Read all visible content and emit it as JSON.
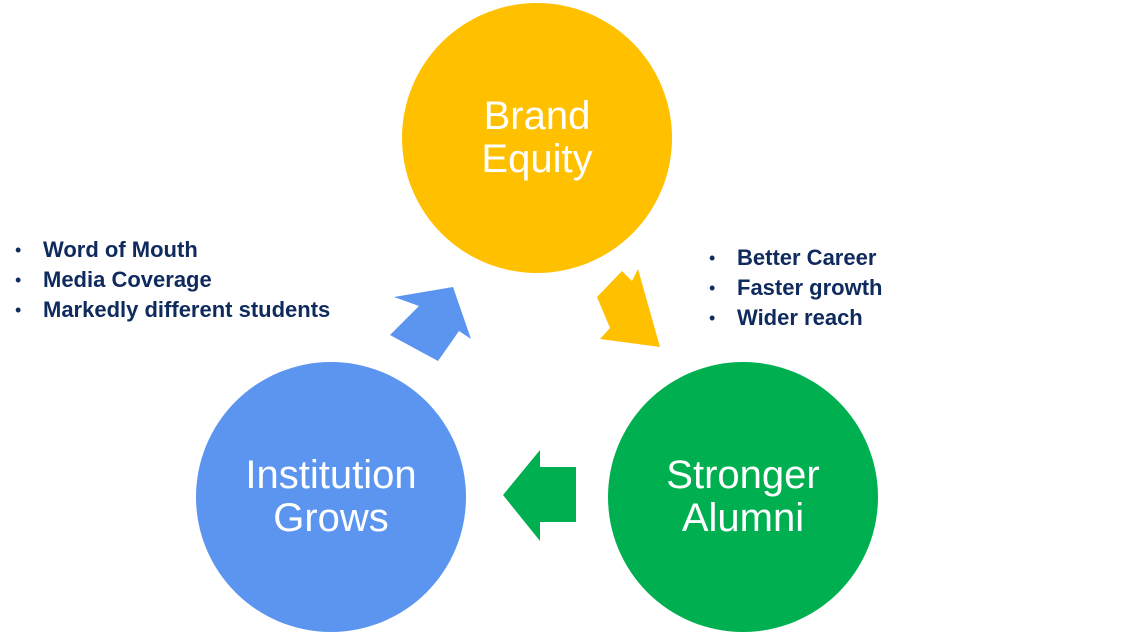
{
  "colors": {
    "brand": "#FFC000",
    "alumni": "#00B050",
    "institution": "#5B95F0",
    "bullet_text": "#0F2A5C",
    "node_text": "#FFFFFF"
  },
  "nodes": {
    "brand_equity": {
      "line1": "Brand",
      "line2": "Equity"
    },
    "stronger_alumni": {
      "line1": "Stronger",
      "line2": "Alumni"
    },
    "institution_grows": {
      "line1": "Institution",
      "line2": "Grows"
    }
  },
  "bullets_left": {
    "items": [
      "Word of Mouth",
      "Media Coverage",
      "Markedly different students"
    ]
  },
  "bullets_right": {
    "items": [
      "Better Career",
      "Faster growth",
      "Wider reach"
    ]
  },
  "arrows": {
    "brand_to_alumni": {
      "icon": "arrow-down-right-icon"
    },
    "alumni_to_institution": {
      "icon": "arrow-left-icon"
    },
    "institution_to_brand": {
      "icon": "arrow-up-right-icon"
    }
  }
}
